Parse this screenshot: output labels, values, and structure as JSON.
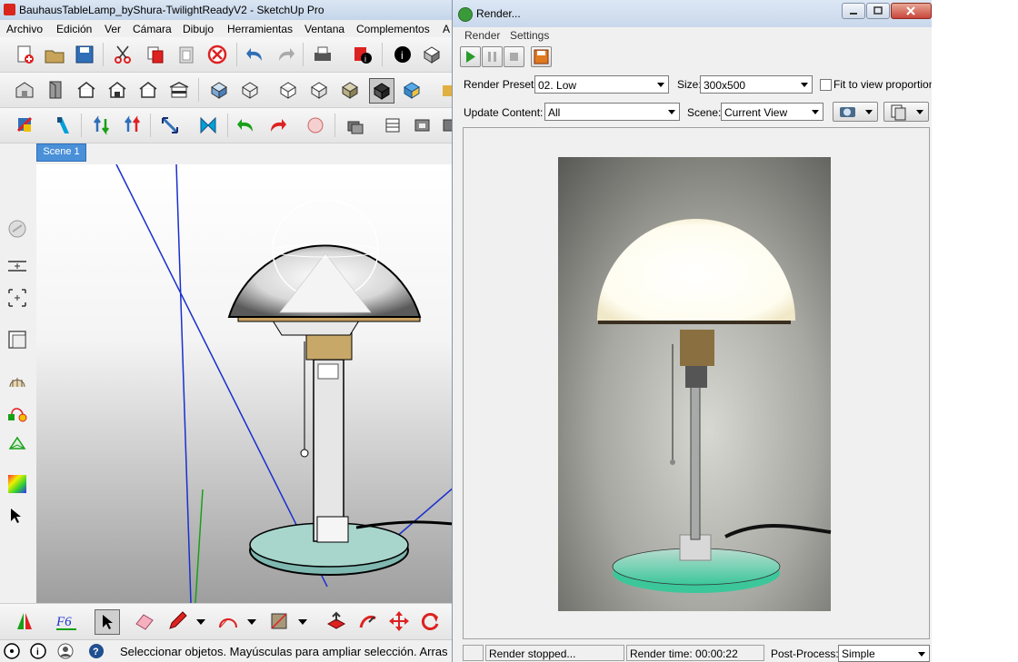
{
  "sketchup": {
    "title": "BauhausTableLamp_byShura-TwilightReadyV2 - SketchUp Pro",
    "menu": [
      "Archivo",
      "Edición",
      "Ver",
      "Cámara",
      "Dibujo",
      "Herramientas",
      "Ventana",
      "Complementos",
      "A"
    ],
    "scene_tab": "Scene 1",
    "status_message": "Seleccionar objetos. Mayúsculas para ampliar selección. Arras",
    "icons": [
      "new-file-icon",
      "open-folder-icon",
      "save-icon",
      "cut-icon",
      "copy-icon",
      "paste-icon",
      "erase-icon",
      "undo-icon",
      "redo-icon",
      "print-icon",
      "model-info-icon",
      "3d-warehouse-icon",
      "component-icon",
      "iso-view-icon",
      "top-view-icon",
      "front-view-icon",
      "right-view-icon",
      "back-view-icon",
      "left-view-icon",
      "xray-icon",
      "wireframe-icon",
      "hidden-line-icon",
      "shaded-icon",
      "shaded-texture-icon",
      "monochrome-icon",
      "select-icon",
      "paint-icon",
      "pencil-icon",
      "arc-icon",
      "rectangle-icon",
      "push-pull-icon",
      "follow-me-icon",
      "move-icon",
      "rotate-icon"
    ]
  },
  "render": {
    "title": "Render...",
    "menu": [
      "Render",
      "Settings"
    ],
    "preset_label": "Render Preset:",
    "preset_value": "02. Low",
    "size_label": "Size:",
    "size_value": "300x500",
    "fit_label": "Fit to view proportion",
    "update_label": "Update Content:",
    "update_value": "All",
    "scene_label": "Scene:",
    "scene_value": "Current View",
    "status_text": "Render stopped...",
    "render_time": "Render time: 00:00:22",
    "postprocess_label": "Post-Process:",
    "postprocess_value": "Simple"
  },
  "colors": {
    "scene_tab": "#4a90d9",
    "axis_blue": "#1a2fcf",
    "axis_green": "#18a018",
    "glass_green": "#3cc79a"
  }
}
